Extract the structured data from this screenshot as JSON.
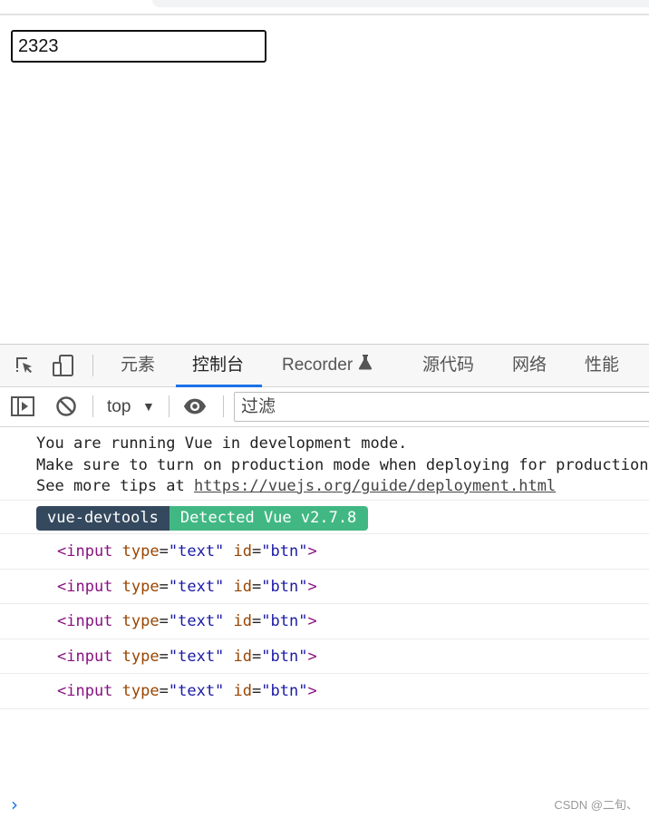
{
  "page": {
    "input_value": "2323"
  },
  "devtools": {
    "tabs": [
      "元素",
      "控制台",
      "Recorder",
      "源代码",
      "网络",
      "性能"
    ],
    "active_tab": "控制台",
    "context": "top",
    "context_arrow": "▼",
    "filter_placeholder": "过滤",
    "icons": {
      "inspect": "inspect-element-icon",
      "device": "device-toolbar-icon",
      "sidebar": "console-sidebar-icon",
      "clear": "clear-console-icon",
      "eye": "live-expression-icon",
      "flask": "experimental-flask-icon"
    }
  },
  "console": {
    "vue_message": {
      "line1": "You are running Vue in development mode.",
      "line2": "Make sure to turn on production mode when deploying for production.",
      "line3_prefix": "See more tips at ",
      "line3_link": "https://vuejs.org/guide/deployment.html"
    },
    "badge": {
      "left": "vue-devtools",
      "right": "Detected Vue v2.7.8"
    },
    "element_logs": [
      {
        "tag_open": "<input",
        "a1": "type",
        "v1": "\"text\"",
        "a2": "id",
        "v2": "\"btn\"",
        "tag_close": ">"
      },
      {
        "tag_open": "<input",
        "a1": "type",
        "v1": "\"text\"",
        "a2": "id",
        "v2": "\"btn\"",
        "tag_close": ">"
      },
      {
        "tag_open": "<input",
        "a1": "type",
        "v1": "\"text\"",
        "a2": "id",
        "v2": "\"btn\"",
        "tag_close": ">"
      },
      {
        "tag_open": "<input",
        "a1": "type",
        "v1": "\"text\"",
        "a2": "id",
        "v2": "\"btn\"",
        "tag_close": ">"
      },
      {
        "tag_open": "<input",
        "a1": "type",
        "v1": "\"text\"",
        "a2": "id",
        "v2": "\"btn\"",
        "tag_close": ">"
      }
    ],
    "prompt": "›"
  },
  "watermark": "CSDN @二旬、",
  "colors": {
    "accent": "#1a73e8",
    "vue_dark": "#35495e",
    "vue_green": "#41b883",
    "tag": "#881280",
    "attr": "#994500",
    "value": "#1a1aa6"
  }
}
